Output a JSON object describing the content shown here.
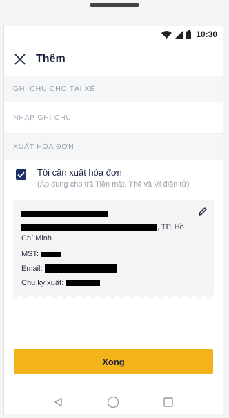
{
  "status_bar": {
    "time": "10:30"
  },
  "header": {
    "title": "Thêm"
  },
  "driver_note": {
    "section_label": "GHI CHÚ CHO TÀI XẾ",
    "placeholder": "NHẬP GHI CHÚ"
  },
  "invoice": {
    "section_label": "XUẤT HÓA ĐƠN",
    "checkbox_label": "Tôi cần xuất hóa đơn",
    "checkbox_checked": true,
    "checkbox_note": "(Áp dụng cho trả Tiền mặt, Thẻ và Ví điện tử)",
    "address_suffix": ", TP. Hồ",
    "address_line2": "Chí Minh",
    "tax_label": "MST:",
    "email_label": "Email:",
    "cycle_label": "Chu kỳ xuất:"
  },
  "actions": {
    "done_label": "Xong"
  },
  "colors": {
    "accent": "#f3b41b",
    "primary_dark": "#1f3067",
    "section_bg": "#f5f6f8",
    "card_bg": "#f4f4f5"
  },
  "icons": [
    "close-icon",
    "wifi-icon",
    "signal-icon",
    "battery-icon",
    "check-icon",
    "pencil-icon",
    "back-icon",
    "home-icon",
    "recents-icon"
  ]
}
